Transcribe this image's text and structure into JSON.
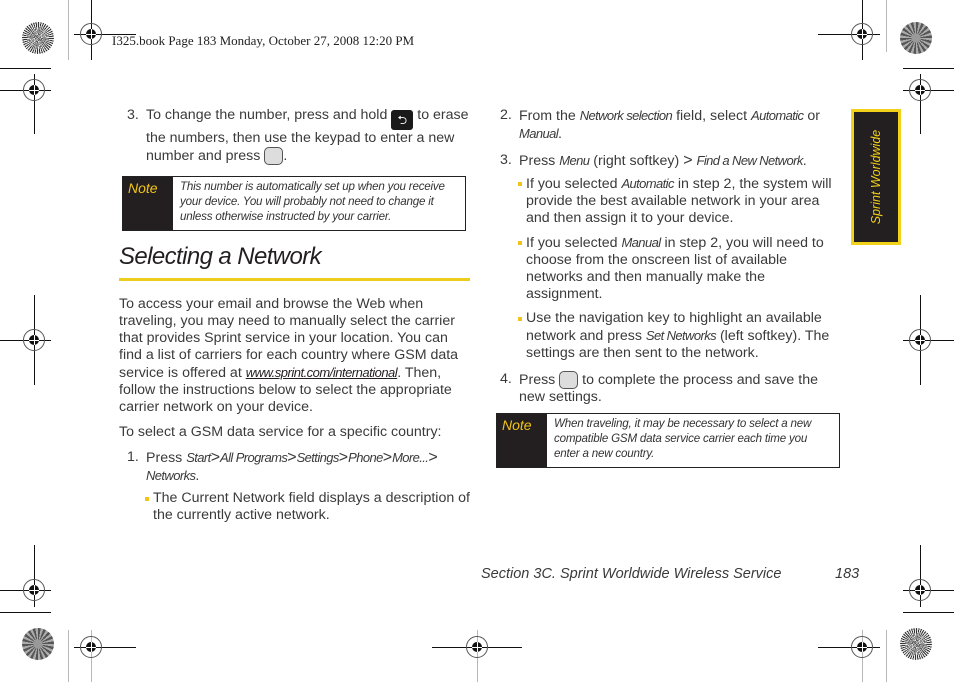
{
  "print_header": {
    "text": "I325.book  Page 183  Monday, October 27, 2008  12:20 PM"
  },
  "left_column": {
    "step3": {
      "number": "3.",
      "text_before_key": "To change the number, press and hold",
      "back_key_icon": "back-key-icon",
      "text_after_key": "to erase the numbers, then use the keypad to enter a new number and press",
      "ok_key_icon": "ok-key-icon",
      "end": "."
    },
    "note1": {
      "label": "Note",
      "text": "This number is automatically set up when you receive your device. You will probably not need to change it unless otherwise instructed by your carrier."
    },
    "section_title": "Selecting a Network",
    "intro_paragraph": {
      "before_link": "To access your email and browse the Web when traveling, you may need to manually select the carrier that provides Sprint service in your location. You can find a list of carriers for each country where GSM data service is offered at",
      "link": "www.sprint.com/international",
      "after_link": ". Then, follow the instructions below to select the appropriate carrier network on your device."
    },
    "lead_in": "To select a GSM data service for a specific country:",
    "step1": {
      "number": "1.",
      "press": "Press",
      "path": [
        "Start",
        "All Programs",
        "Settings",
        "Phone",
        "More...",
        "Networks"
      ],
      "separator": ">",
      "end": "."
    },
    "step1_bullet": "The Current Network field displays a description of the currently active network."
  },
  "right_column": {
    "step2": {
      "number": "2.",
      "t1": "From the",
      "field": "Network selection",
      "t2": "field, select",
      "opt1": "Automatic",
      "t3": "or",
      "opt2": "Manual",
      "end": "."
    },
    "step3": {
      "number": "3.",
      "press": "Press",
      "menu": "Menu",
      "t2": "(right softkey)",
      "separator": ">",
      "item": "Find a New Network",
      "end": "."
    },
    "bullets": [
      {
        "t1": "If you selected",
        "em": "Automatic",
        "t2": "in step 2, the system will provide the best available network in your area and then assign it to your device."
      },
      {
        "t1": "If you selected",
        "em": "Manual",
        "t2": "in step 2, you will need to choose from the onscreen list of available networks and then manually make the assignment."
      },
      {
        "t1": "Use the navigation key to highlight an available network and press",
        "em": "Set Networks",
        "t2": "(left softkey). The settings are then sent to the network."
      }
    ],
    "step4": {
      "number": "4.",
      "press": "Press",
      "ok_key_icon": "ok-key-icon",
      "text": "to complete the process and save the new settings."
    },
    "note2": {
      "label": "Note",
      "text": "When traveling, it may be necessary to select a new compatible GSM data service carrier each time you enter a new country."
    }
  },
  "side_tab": {
    "label": "Sprint Worldwide"
  },
  "footer": {
    "section": "Section 3C. Sprint Worldwide Wireless Service",
    "page_number": "183"
  },
  "colors": {
    "accent_yellow": "#f2d11a",
    "dark_fill": "#231f20",
    "body_text": "#3a3a3a"
  }
}
